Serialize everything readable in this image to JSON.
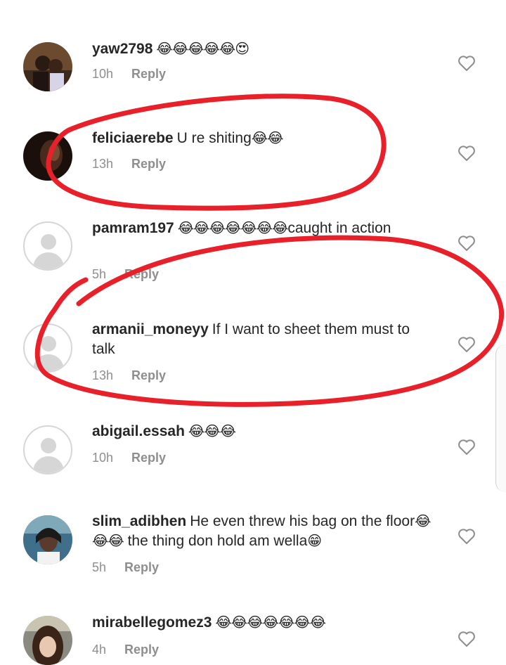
{
  "comments": [
    {
      "user": "yaw2798",
      "text": "",
      "emoji": "😂😂😂😂😂😍",
      "time": "10h",
      "reply": "Reply"
    },
    {
      "user": "feliciaerebe",
      "text": "U re shiting",
      "emoji": "😂😂",
      "time": "13h",
      "reply": "Reply"
    },
    {
      "user": "pamram197",
      "text": "caught in action",
      "emoji": "😂😂😂😂😂😂😂",
      "time": "5h",
      "reply": "Reply"
    },
    {
      "user": "armanii_moneyy",
      "text": "If I want to sheet them must to talk",
      "emoji": "",
      "time": "13h",
      "reply": "Reply"
    },
    {
      "user": "abigail.essah",
      "text": "",
      "emoji": "😂😂😂",
      "time": "10h",
      "reply": "Reply"
    },
    {
      "user": "slim_adibhen",
      "text_before": "He even threw his bag on the floor",
      "emoji": "😂😂😂",
      "text_after": " the thing don hold am wella",
      "emoji2": "😁",
      "time": "5h",
      "reply": "Reply"
    },
    {
      "user": "mirabellegomez3",
      "text": "",
      "emoji": "😂😂😂😂😂😂😂",
      "time": "4h",
      "reply": "Reply"
    }
  ],
  "icons": {
    "like": "heart-outline-icon",
    "avatar_placeholder": "default-avatar-icon"
  },
  "colors": {
    "annotation": "#e8202a",
    "muted": "#8e8e8e",
    "text": "#262626"
  }
}
